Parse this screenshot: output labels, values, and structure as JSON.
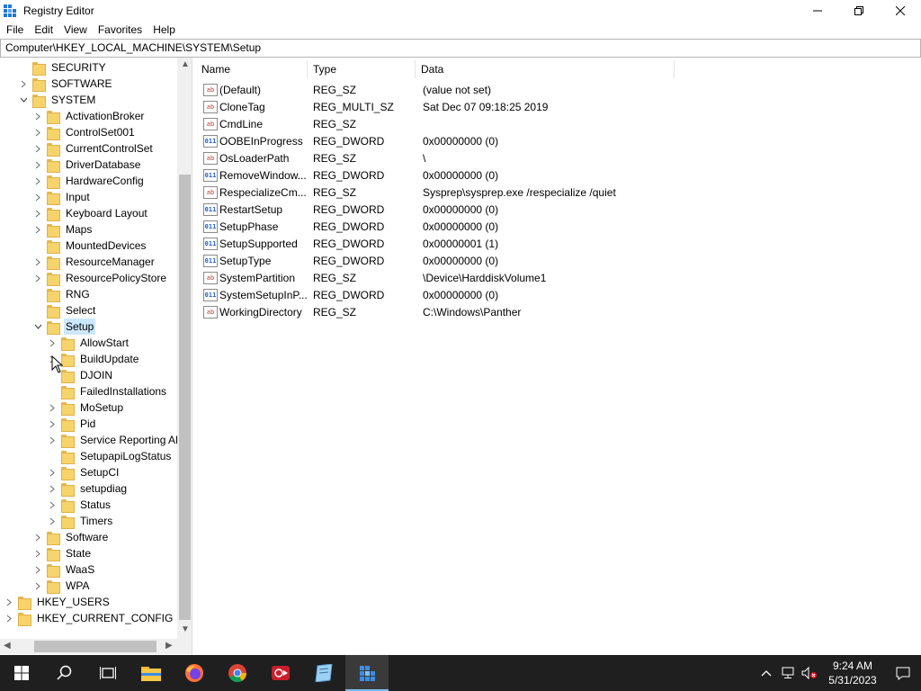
{
  "window": {
    "title": "Registry Editor"
  },
  "menu": [
    "File",
    "Edit",
    "View",
    "Favorites",
    "Help"
  ],
  "address": "Computer\\HKEY_LOCAL_MACHINE\\SYSTEM\\Setup",
  "tree": [
    {
      "label": "SECURITY",
      "level": 1,
      "chevron": "none"
    },
    {
      "label": "SOFTWARE",
      "level": 1,
      "chevron": "right"
    },
    {
      "label": "SYSTEM",
      "level": 1,
      "chevron": "down"
    },
    {
      "label": "ActivationBroker",
      "level": 2,
      "chevron": "right"
    },
    {
      "label": "ControlSet001",
      "level": 2,
      "chevron": "right"
    },
    {
      "label": "CurrentControlSet",
      "level": 2,
      "chevron": "right"
    },
    {
      "label": "DriverDatabase",
      "level": 2,
      "chevron": "right"
    },
    {
      "label": "HardwareConfig",
      "level": 2,
      "chevron": "right"
    },
    {
      "label": "Input",
      "level": 2,
      "chevron": "right"
    },
    {
      "label": "Keyboard Layout",
      "level": 2,
      "chevron": "right"
    },
    {
      "label": "Maps",
      "level": 2,
      "chevron": "right"
    },
    {
      "label": "MountedDevices",
      "level": 2,
      "chevron": "none"
    },
    {
      "label": "ResourceManager",
      "level": 2,
      "chevron": "right"
    },
    {
      "label": "ResourcePolicyStore",
      "level": 2,
      "chevron": "right"
    },
    {
      "label": "RNG",
      "level": 2,
      "chevron": "none"
    },
    {
      "label": "Select",
      "level": 2,
      "chevron": "none"
    },
    {
      "label": "Setup",
      "level": 2,
      "chevron": "down",
      "selected": true
    },
    {
      "label": "AllowStart",
      "level": 3,
      "chevron": "right"
    },
    {
      "label": "BuildUpdate",
      "level": 3,
      "chevron": "right"
    },
    {
      "label": "DJOIN",
      "level": 3,
      "chevron": "none"
    },
    {
      "label": "FailedInstallations",
      "level": 3,
      "chevron": "none"
    },
    {
      "label": "MoSetup",
      "level": 3,
      "chevron": "right"
    },
    {
      "label": "Pid",
      "level": 3,
      "chevron": "right"
    },
    {
      "label": "Service Reporting API",
      "level": 3,
      "chevron": "right"
    },
    {
      "label": "SetupapiLogStatus",
      "level": 3,
      "chevron": "none"
    },
    {
      "label": "SetupCI",
      "level": 3,
      "chevron": "right"
    },
    {
      "label": "setupdiag",
      "level": 3,
      "chevron": "right"
    },
    {
      "label": "Status",
      "level": 3,
      "chevron": "right"
    },
    {
      "label": "Timers",
      "level": 3,
      "chevron": "right"
    },
    {
      "label": "Software",
      "level": 2,
      "chevron": "right"
    },
    {
      "label": "State",
      "level": 2,
      "chevron": "right"
    },
    {
      "label": "WaaS",
      "level": 2,
      "chevron": "right"
    },
    {
      "label": "WPA",
      "level": 2,
      "chevron": "right"
    },
    {
      "label": "HKEY_USERS",
      "level": 0,
      "chevron": "right"
    },
    {
      "label": "HKEY_CURRENT_CONFIG",
      "level": 0,
      "chevron": "right"
    }
  ],
  "columns": {
    "name": "Name",
    "type": "Type",
    "data": "Data"
  },
  "values": [
    {
      "name": "(Default)",
      "type": "REG_SZ",
      "data": "(value not set)",
      "icon": "string-value-icon"
    },
    {
      "name": "CloneTag",
      "type": "REG_MULTI_SZ",
      "data": "Sat Dec 07 09:18:25 2019",
      "icon": "string-value-icon"
    },
    {
      "name": "CmdLine",
      "type": "REG_SZ",
      "data": "",
      "icon": "string-value-icon"
    },
    {
      "name": "OOBEInProgress",
      "type": "REG_DWORD",
      "data": "0x00000000 (0)",
      "icon": "binary-value-icon"
    },
    {
      "name": "OsLoaderPath",
      "type": "REG_SZ",
      "data": "\\",
      "icon": "string-value-icon"
    },
    {
      "name": "RemoveWindow...",
      "type": "REG_DWORD",
      "data": "0x00000000 (0)",
      "icon": "binary-value-icon"
    },
    {
      "name": "RespecializeCm...",
      "type": "REG_SZ",
      "data": "Sysprep\\sysprep.exe /respecialize /quiet",
      "icon": "string-value-icon"
    },
    {
      "name": "RestartSetup",
      "type": "REG_DWORD",
      "data": "0x00000000 (0)",
      "icon": "binary-value-icon"
    },
    {
      "name": "SetupPhase",
      "type": "REG_DWORD",
      "data": "0x00000000 (0)",
      "icon": "binary-value-icon"
    },
    {
      "name": "SetupSupported",
      "type": "REG_DWORD",
      "data": "0x00000001 (1)",
      "icon": "binary-value-icon"
    },
    {
      "name": "SetupType",
      "type": "REG_DWORD",
      "data": "0x00000000 (0)",
      "icon": "binary-value-icon"
    },
    {
      "name": "SystemPartition",
      "type": "REG_SZ",
      "data": "\\Device\\HarddiskVolume1",
      "icon": "string-value-icon"
    },
    {
      "name": "SystemSetupInP...",
      "type": "REG_DWORD",
      "data": "0x00000000 (0)",
      "icon": "binary-value-icon"
    },
    {
      "name": "WorkingDirectory",
      "type": "REG_SZ",
      "data": "C:\\Windows\\Panther",
      "icon": "string-value-icon"
    }
  ],
  "icon_text": {
    "string": "ab",
    "binary": "011"
  },
  "taskbar": {
    "apps": [
      "file-explorer-icon",
      "firefox-icon",
      "chrome-icon",
      "media-app-icon",
      "notepad-app-icon",
      "registry-editor-icon"
    ],
    "time": "9:24 AM",
    "date": "5/31/2023"
  },
  "colors": {
    "selection": "#cce8ff",
    "folder": "#f6d36b",
    "taskbar": "#1f1f1f",
    "accent": "#76b9ed"
  }
}
